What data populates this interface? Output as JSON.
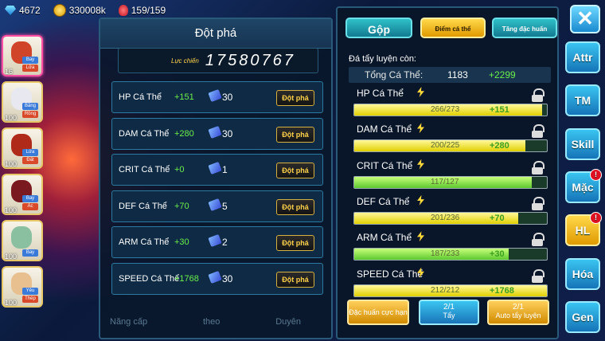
{
  "resources": {
    "gems": "4672",
    "gold": "330008k",
    "stamina": "159/159"
  },
  "party": [
    {
      "level": "16",
      "tags": [
        "Bay",
        "Lửa"
      ],
      "color": "#d0452a",
      "selected": true
    },
    {
      "level": "100",
      "tags": [
        "Băng",
        "Rồng"
      ],
      "color": "#e8e8f0",
      "selected": false
    },
    {
      "level": "100",
      "tags": [
        "Lửa",
        "Đất"
      ],
      "color": "#b02a1a",
      "selected": false
    },
    {
      "level": "100",
      "tags": [
        "Bay",
        "Ác"
      ],
      "color": "#7a1a20",
      "selected": false
    },
    {
      "level": "100",
      "tags": [
        "Bay"
      ],
      "color": "#8ac0a0",
      "selected": false
    },
    {
      "level": "100",
      "tags": [
        "Yêu",
        "Thép"
      ],
      "color": "#e8c090",
      "selected": false
    }
  ],
  "breakthrough": {
    "title": "Đột phá",
    "power_label": "Lực chiến",
    "power_value": "17580767",
    "rows": [
      {
        "name": "HP Cá Thể",
        "bonus": "+151",
        "count": "30",
        "button": "Đột phá"
      },
      {
        "name": "DAM Cá Thể",
        "bonus": "+280",
        "count": "30",
        "button": "Đột phá"
      },
      {
        "name": "CRIT Cá Thể",
        "bonus": "+0",
        "count": "1",
        "button": "Đột phá"
      },
      {
        "name": "DEF Cá Thể",
        "bonus": "+70",
        "count": "5",
        "button": "Đột phá"
      },
      {
        "name": "ARM Cá Thể",
        "bonus": "+30",
        "count": "2",
        "button": "Đột phá"
      },
      {
        "name": "SPEED Cá Thể",
        "bonus": "+1768",
        "count": "30",
        "button": "Đột phá"
      }
    ],
    "background_labels": [
      "Năng cấp",
      "theo",
      "Duyên"
    ]
  },
  "stats_panel": {
    "tabs": [
      "Gộp",
      "Điểm cá thể",
      "Tăng đặc huấn"
    ],
    "remain_label": "Đá tẩy luyện còn:",
    "total_label": "Tổng Cá Thể:",
    "total_value": "1183",
    "total_bonus": "+2299",
    "stats": [
      {
        "name": "HP Cá Thể",
        "value": "266/273",
        "bonus": "+151",
        "fill": 0.974,
        "full": false
      },
      {
        "name": "DAM Cá Thể",
        "value": "200/225",
        "bonus": "+280",
        "fill": 0.889,
        "full": false
      },
      {
        "name": "CRIT Cá Thể",
        "value": "117/127",
        "bonus": "",
        "fill": 0.921,
        "full": true
      },
      {
        "name": "DEF Cá Thể",
        "value": "201/236",
        "bonus": "+70",
        "fill": 0.852,
        "full": false
      },
      {
        "name": "ARM Cá Thể",
        "value": "187/233",
        "bonus": "+30",
        "fill": 0.803,
        "full": true
      },
      {
        "name": "SPEED Cá Thể",
        "value": "212/212",
        "bonus": "+1768",
        "fill": 1.0,
        "full": false
      }
    ],
    "buttons": [
      {
        "label": "Đặc huấn cực hạn",
        "count": ""
      },
      {
        "label": "Tẩy",
        "count": "2/1"
      },
      {
        "label": "Auto tẩy luyện",
        "count": "2/1"
      }
    ]
  },
  "nav": {
    "close": "✕",
    "items": [
      {
        "label": "Attr",
        "badge": false,
        "active": false
      },
      {
        "label": "TM",
        "badge": false,
        "active": false
      },
      {
        "label": "Skill",
        "badge": false,
        "active": false
      },
      {
        "label": "Mặc",
        "badge": true,
        "active": false
      },
      {
        "label": "HL",
        "badge": true,
        "active": true
      },
      {
        "label": "Hóa",
        "badge": false,
        "active": false
      },
      {
        "label": "Gen",
        "badge": false,
        "active": false
      }
    ]
  }
}
